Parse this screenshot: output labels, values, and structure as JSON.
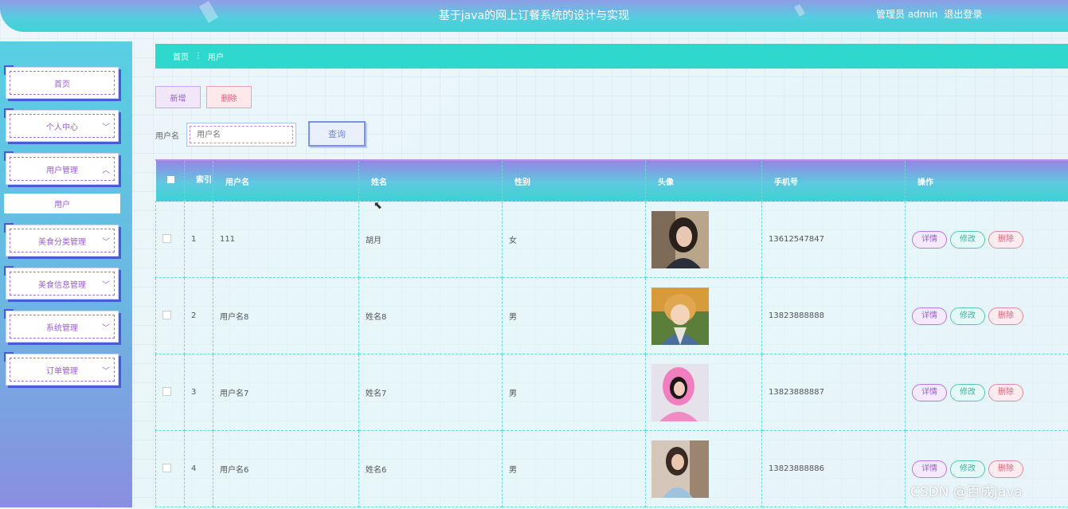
{
  "header": {
    "title": "基于java的网上订餐系统的设计与实现",
    "role_user": "管理员 admin",
    "logout": "退出登录"
  },
  "sidebar": {
    "items": [
      {
        "label": "首页",
        "has_chevron": false
      },
      {
        "label": "个人中心",
        "has_chevron": true,
        "chevron": "﹀"
      },
      {
        "label": "用户管理",
        "has_chevron": true,
        "chevron": "︿"
      },
      {
        "label": "美食分类管理",
        "has_chevron": true,
        "chevron": "﹀"
      },
      {
        "label": "美食信息管理",
        "has_chevron": true,
        "chevron": "﹀"
      },
      {
        "label": "系统管理",
        "has_chevron": true,
        "chevron": "﹀"
      },
      {
        "label": "订单管理",
        "has_chevron": true,
        "chevron": "﹀"
      }
    ],
    "sub_item": "用户"
  },
  "breadcrumb": {
    "home": "首页",
    "separator": "⋮",
    "current": "用户"
  },
  "actions": {
    "add": "新增",
    "delete": "删除"
  },
  "search": {
    "label": "用户名",
    "placeholder": "用户名",
    "button": "查询"
  },
  "table": {
    "headers": [
      "索引",
      "用户名",
      "姓名",
      "性别",
      "头像",
      "手机号",
      "操作"
    ],
    "rows": [
      {
        "index": "1",
        "username": "111",
        "name": "胡月",
        "gender": "女",
        "avatar": "portrait-woman-1",
        "phone": "13612547847"
      },
      {
        "index": "2",
        "username": "用户名8",
        "name": "姓名8",
        "gender": "男",
        "avatar": "anime-boy",
        "phone": "13823888888"
      },
      {
        "index": "3",
        "username": "用户名7",
        "name": "姓名7",
        "gender": "男",
        "avatar": "portrait-pink-hoodie",
        "phone": "13823888887"
      },
      {
        "index": "4",
        "username": "用户名6",
        "name": "姓名6",
        "gender": "男",
        "avatar": "portrait-woman-street",
        "phone": "13823888886"
      }
    ],
    "row_actions": {
      "detail": "详情",
      "edit": "修改",
      "delete": "删除"
    }
  },
  "watermark": "CSDN @百成Java",
  "colors": {
    "accent_teal": "#2fd8cd",
    "accent_purple": "#9a5fcf",
    "danger": "#d9607a"
  }
}
